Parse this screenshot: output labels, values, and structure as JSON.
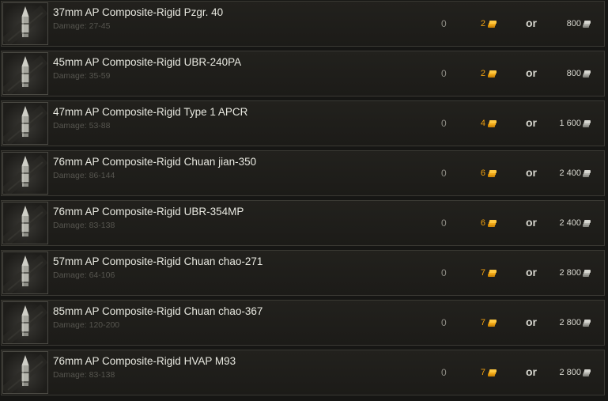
{
  "damage_label": "Damage:",
  "or_label": "or",
  "currency_colors": {
    "gold": "#f0a010",
    "credits": "#d8d8d0"
  },
  "shells": [
    {
      "name": "37mm AP Composite-Rigid Pzgr. 40",
      "damage": "27-45",
      "stock": "0",
      "gold_price": "2",
      "credit_price": "800",
      "icon": "ap-shell-icon"
    },
    {
      "name": "45mm AP Composite-Rigid UBR-240PA",
      "damage": "35-59",
      "stock": "0",
      "gold_price": "2",
      "credit_price": "800",
      "icon": "ap-shell-icon"
    },
    {
      "name": "47mm AP Composite-Rigid Type 1 APCR",
      "damage": "53-88",
      "stock": "0",
      "gold_price": "4",
      "credit_price": "1 600",
      "icon": "ap-shell-icon"
    },
    {
      "name": "76mm AP Composite-Rigid Chuan jian-350",
      "damage": "86-144",
      "stock": "0",
      "gold_price": "6",
      "credit_price": "2 400",
      "icon": "ap-shell-icon"
    },
    {
      "name": "76mm AP Composite-Rigid UBR-354MP",
      "damage": "83-138",
      "stock": "0",
      "gold_price": "6",
      "credit_price": "2 400",
      "icon": "ap-shell-icon"
    },
    {
      "name": "57mm AP Composite-Rigid Chuan chao-271",
      "damage": "64-106",
      "stock": "0",
      "gold_price": "7",
      "credit_price": "2 800",
      "icon": "ap-shell-icon"
    },
    {
      "name": "85mm AP Composite-Rigid Chuan chao-367",
      "damage": "120-200",
      "stock": "0",
      "gold_price": "7",
      "credit_price": "2 800",
      "icon": "ap-shell-icon"
    },
    {
      "name": "76mm AP Composite-Rigid HVAP M93",
      "damage": "83-138",
      "stock": "0",
      "gold_price": "7",
      "credit_price": "2 800",
      "icon": "ap-shell-icon"
    }
  ]
}
